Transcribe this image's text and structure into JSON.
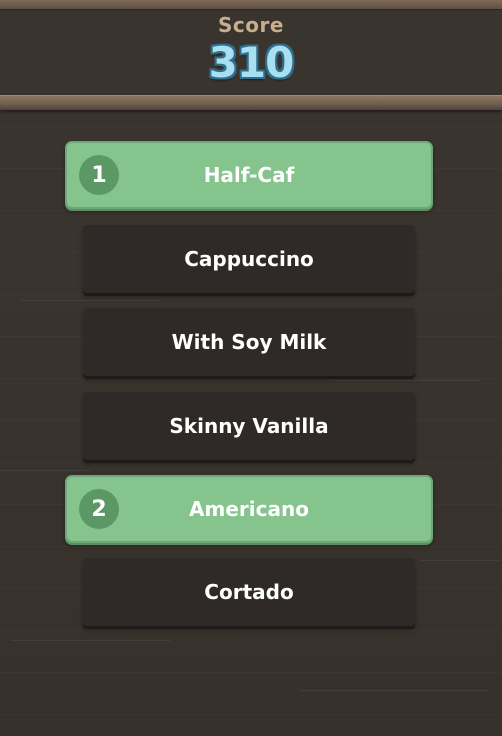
{
  "score": {
    "label": "Score",
    "value": "310"
  },
  "items": [
    {
      "label": "Half-Caf",
      "selected": true,
      "rank": "1"
    },
    {
      "label": "Cappuccino",
      "selected": false
    },
    {
      "label": "With Soy Milk",
      "selected": false
    },
    {
      "label": "Skinny Vanilla",
      "selected": false
    },
    {
      "label": "Americano",
      "selected": true,
      "rank": "2"
    },
    {
      "label": "Cortado",
      "selected": false
    }
  ],
  "colors": {
    "selected_fill": "#85c48d",
    "item_dark": "#2f2a27",
    "score_value": "#a9dff0",
    "score_label": "#c9ae8e",
    "background": "#3a342f"
  }
}
